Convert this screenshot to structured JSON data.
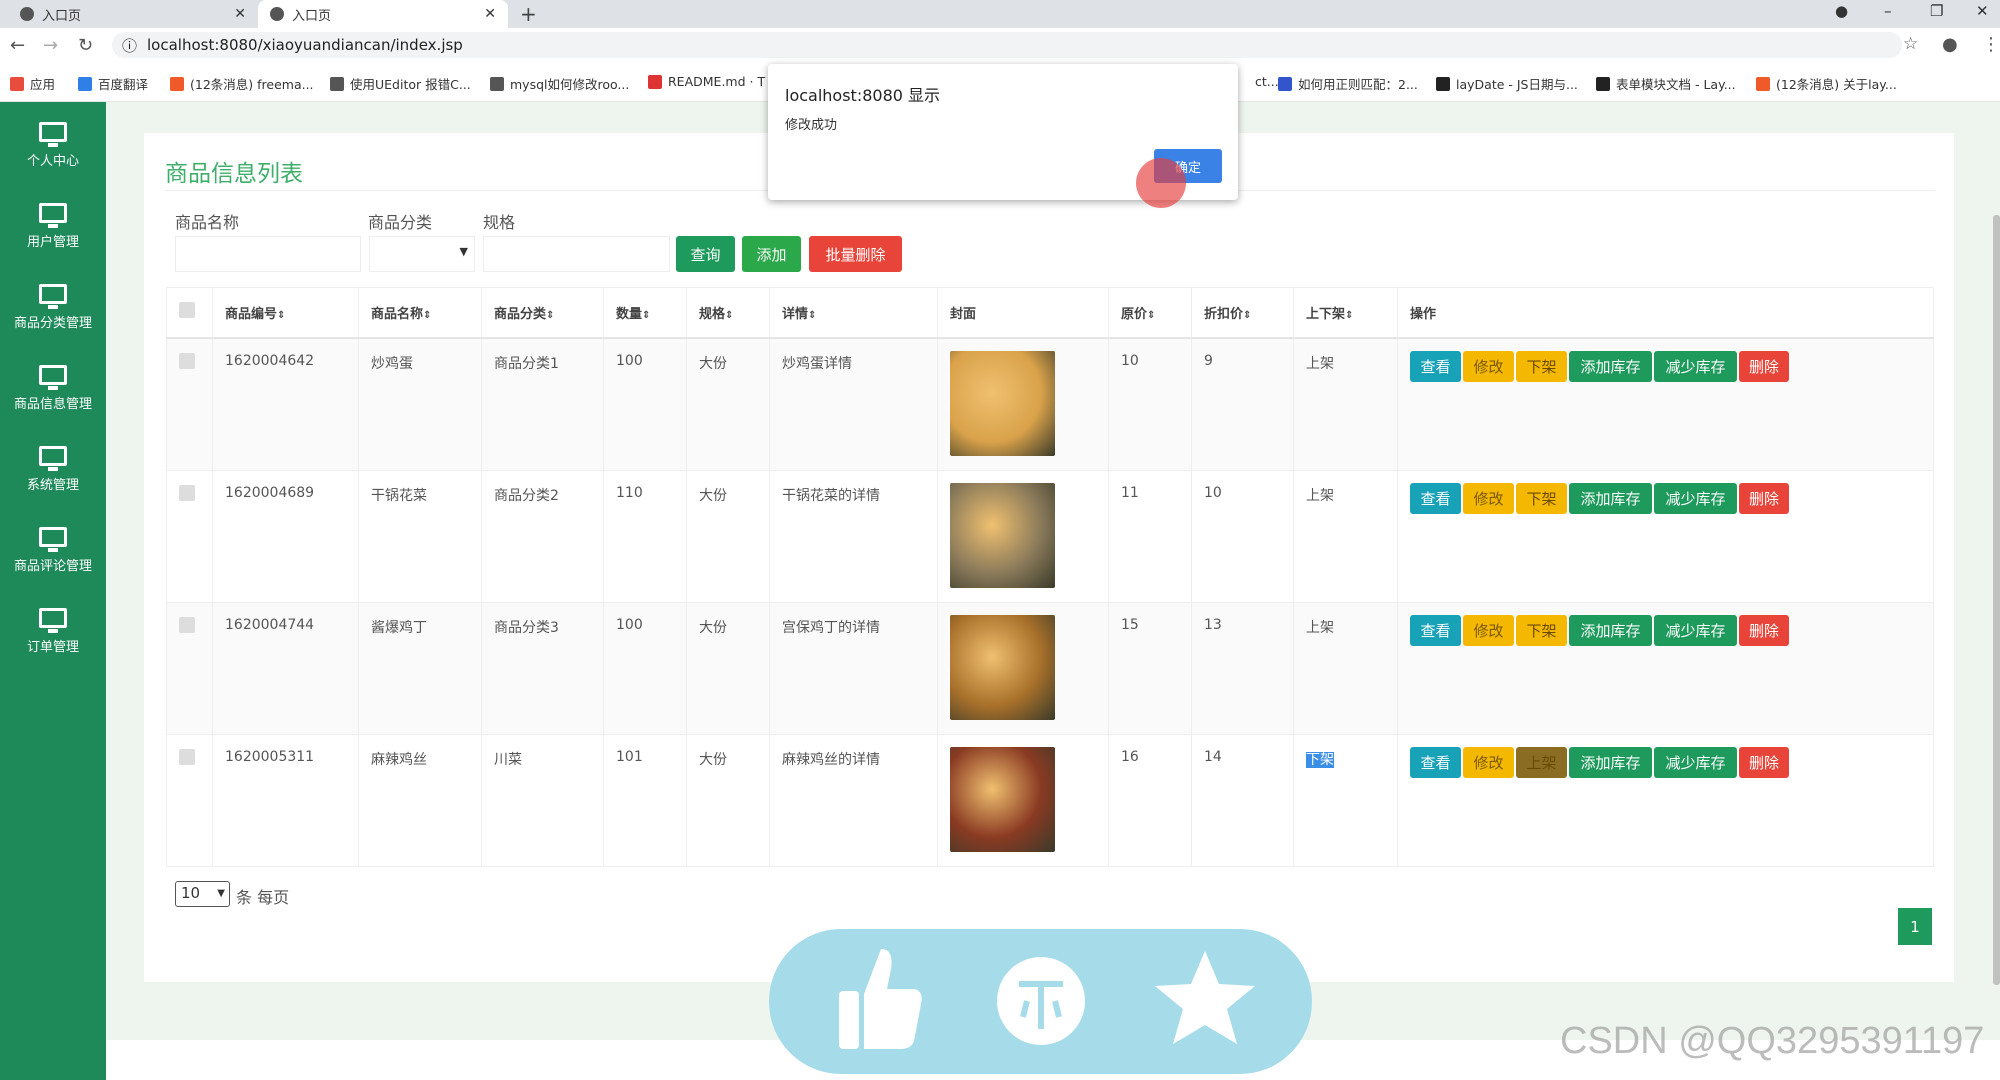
{
  "browser": {
    "tabs": [
      {
        "title": "入口页",
        "active": false
      },
      {
        "title": "入口页",
        "active": true
      }
    ],
    "url": "localhost:8080/xiaoyuandiancan/index.jsp",
    "bookmarks": [
      {
        "label": "应用",
        "color": "#e74c3c"
      },
      {
        "label": "百度翻译",
        "color": "#2f7fe6"
      },
      {
        "label": "(12条消息) freema...",
        "color": "#f05a28"
      },
      {
        "label": "使用UEditor 报错C...",
        "color": "#555"
      },
      {
        "label": "mysql如何修改roo...",
        "color": "#555"
      },
      {
        "label": "README.md · T",
        "color": "#d33"
      },
      {
        "label": "ct...",
        "color": "#fff"
      },
      {
        "label": "如何用正则匹配：2...",
        "color": "#3355cc"
      },
      {
        "label": "layDate - JS日期与...",
        "color": "#222"
      },
      {
        "label": "表单模块文档 - Lay...",
        "color": "#222"
      },
      {
        "label": "(12条消息) 关于lay...",
        "color": "#f05a28"
      }
    ]
  },
  "sidebar": {
    "items": [
      {
        "label": "个人中心"
      },
      {
        "label": "用户管理"
      },
      {
        "label": "商品分类管理"
      },
      {
        "label": "商品信息管理"
      },
      {
        "label": "系统管理"
      },
      {
        "label": "商品评论管理"
      },
      {
        "label": "订单管理"
      }
    ]
  },
  "page": {
    "title": "商品信息列表",
    "filters": {
      "name_label": "商品名称",
      "category_label": "商品分类",
      "spec_label": "规格"
    },
    "buttons": {
      "search": "查询",
      "add": "添加",
      "batch_delete": "批量删除"
    },
    "columns": [
      "商品编号",
      "商品名称",
      "商品分类",
      "数量",
      "规格",
      "详情",
      "封面",
      "原价",
      "折扣价",
      "上下架",
      "操作"
    ],
    "sort_icon": "⇕",
    "rows": [
      {
        "id": "1620004642",
        "name": "炒鸡蛋",
        "category": "商品分类1",
        "qty": "100",
        "spec": "大份",
        "detail": "炒鸡蛋详情",
        "price": "10",
        "discount": "9",
        "status": "上架",
        "toggle": "下架",
        "img": "#d9a24a"
      },
      {
        "id": "1620004689",
        "name": "干锅花菜",
        "category": "商品分类2",
        "qty": "110",
        "spec": "大份",
        "detail": "干锅花菜的详情",
        "price": "11",
        "discount": "10",
        "status": "上架",
        "toggle": "下架",
        "img": "#8a7a5a"
      },
      {
        "id": "1620004744",
        "name": "酱爆鸡丁",
        "category": "商品分类3",
        "qty": "100",
        "spec": "大份",
        "detail": "宫保鸡丁的详情",
        "price": "15",
        "discount": "13",
        "status": "上架",
        "toggle": "下架",
        "img": "#a8702a"
      },
      {
        "id": "1620005311",
        "name": "麻辣鸡丝",
        "category": "川菜",
        "qty": "101",
        "spec": "大份",
        "detail": "麻辣鸡丝的详情",
        "price": "16",
        "discount": "14",
        "status": "下架",
        "toggle": "上架",
        "img": "#8a3a22"
      }
    ],
    "ops": {
      "view": "查看",
      "edit": "修改",
      "add_stock": "添加库存",
      "reduce_stock": "减少库存",
      "delete": "删除"
    },
    "pagination": {
      "page_size": "10",
      "per_page_label": "条 每页",
      "current_page": "1"
    }
  },
  "dialog": {
    "title": "localhost:8080 显示",
    "message": "修改成功",
    "ok": "确定"
  },
  "watermark": "CSDN @QQ3295391197"
}
